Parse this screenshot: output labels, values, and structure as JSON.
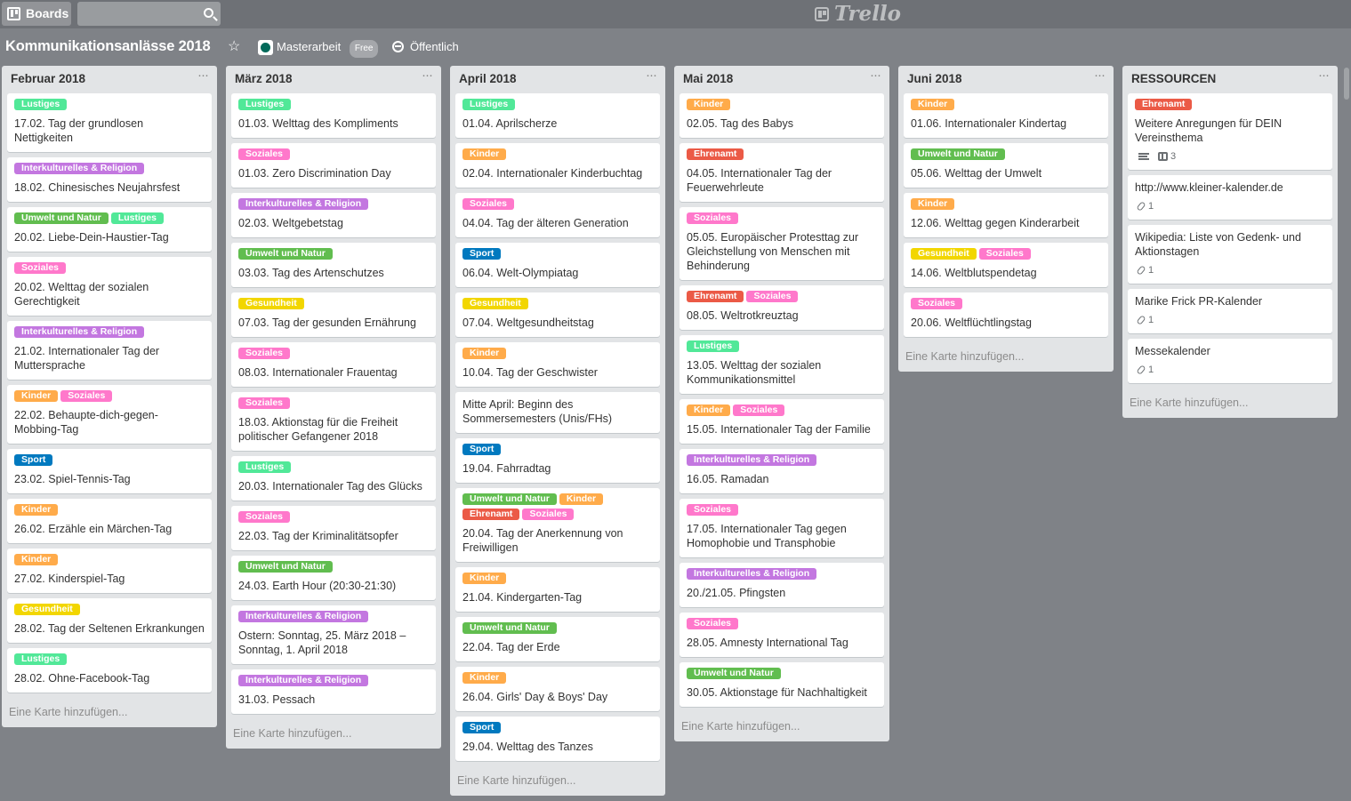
{
  "header": {
    "boards_label": "Boards",
    "search_placeholder": "",
    "logo_text": "Trello"
  },
  "board": {
    "title": "Kommunikationsanlässe 2018",
    "team": "Masterarbeit",
    "team_badge": "Free",
    "visibility": "Öffentlich"
  },
  "colors": {
    "Lustiges": "#51e898",
    "Interkulturelles & Religion": "#c377e0",
    "Umwelt und Natur": "#61bd4f",
    "Soziales": "#ff78cb",
    "Kinder": "#ffab4a",
    "Sport": "#0079bf",
    "Gesundheit": "#f2d600",
    "Ehrenamt": "#eb5a46"
  },
  "lists": [
    {
      "title": "Februar 2018",
      "add_label": "Eine Karte hinzufügen...",
      "cards": [
        {
          "labels": [
            "Lustiges"
          ],
          "title": "17.02. Tag der grundlosen Nettigkeiten"
        },
        {
          "labels": [
            "Interkulturelles & Religion"
          ],
          "title": "18.02. Chinesisches Neujahrsfest"
        },
        {
          "labels": [
            "Umwelt und Natur",
            "Lustiges"
          ],
          "title": "20.02. Liebe-Dein-Haustier-Tag"
        },
        {
          "labels": [
            "Soziales"
          ],
          "title": "20.02. Welttag der sozialen Gerechtigkeit"
        },
        {
          "labels": [
            "Interkulturelles & Religion"
          ],
          "title": "21.02. Internationaler Tag der Muttersprache"
        },
        {
          "labels": [
            "Kinder",
            "Soziales"
          ],
          "title": "22.02. Behaupte-dich-gegen-Mobbing-Tag"
        },
        {
          "labels": [
            "Sport"
          ],
          "title": "23.02. Spiel-Tennis-Tag"
        },
        {
          "labels": [
            "Kinder"
          ],
          "title": "26.02. Erzähle ein Märchen-Tag"
        },
        {
          "labels": [
            "Kinder"
          ],
          "title": "27.02. Kinderspiel-Tag"
        },
        {
          "labels": [
            "Gesundheit"
          ],
          "title": "28.02. Tag der Seltenen Erkrankungen"
        },
        {
          "labels": [
            "Lustiges"
          ],
          "title": "28.02. Ohne-Facebook-Tag"
        }
      ]
    },
    {
      "title": "März 2018",
      "add_label": "Eine Karte hinzufügen...",
      "cards": [
        {
          "labels": [
            "Lustiges"
          ],
          "title": "01.03. Welttag des Kompliments"
        },
        {
          "labels": [
            "Soziales"
          ],
          "title": "01.03. Zero Discrimination Day"
        },
        {
          "labels": [
            "Interkulturelles & Religion"
          ],
          "title": "02.03. Weltgebetstag"
        },
        {
          "labels": [
            "Umwelt und Natur"
          ],
          "title": "03.03. Tag des Artenschutzes"
        },
        {
          "labels": [
            "Gesundheit"
          ],
          "title": "07.03. Tag der gesunden Ernährung"
        },
        {
          "labels": [
            "Soziales"
          ],
          "title": "08.03. Internationaler Frauentag"
        },
        {
          "labels": [
            "Soziales"
          ],
          "title": "18.03. Aktionstag für die Freiheit politischer Gefangener 2018"
        },
        {
          "labels": [
            "Lustiges"
          ],
          "title": "20.03. Internationaler Tag des Glücks"
        },
        {
          "labels": [
            "Soziales"
          ],
          "title": "22.03. Tag der Kriminalitätsopfer"
        },
        {
          "labels": [
            "Umwelt und Natur"
          ],
          "title": "24.03. Earth Hour (20:30-21:30)"
        },
        {
          "labels": [
            "Interkulturelles & Religion"
          ],
          "title": "Ostern: Sonntag, 25. März 2018 – Sonntag, 1. April 2018"
        },
        {
          "labels": [
            "Interkulturelles & Religion"
          ],
          "title": "31.03. Pessach"
        }
      ]
    },
    {
      "title": "April 2018",
      "add_label": "Eine Karte hinzufügen...",
      "cards": [
        {
          "labels": [
            "Lustiges"
          ],
          "title": "01.04. Aprilscherze"
        },
        {
          "labels": [
            "Kinder"
          ],
          "title": "02.04. Internationaler Kinderbuchtag"
        },
        {
          "labels": [
            "Soziales"
          ],
          "title": "04.04. Tag der älteren Generation"
        },
        {
          "labels": [
            "Sport"
          ],
          "title": "06.04. Welt-Olympiatag"
        },
        {
          "labels": [
            "Gesundheit"
          ],
          "title": "07.04. Weltgesundheitstag"
        },
        {
          "labels": [
            "Kinder"
          ],
          "title": "10.04. Tag der Geschwister"
        },
        {
          "labels": [],
          "title": "Mitte April: Beginn des Sommersemesters (Unis/FHs)"
        },
        {
          "labels": [
            "Sport"
          ],
          "title": "19.04. Fahrradtag"
        },
        {
          "labels": [
            "Umwelt und Natur",
            "Kinder",
            "Ehrenamt",
            "Soziales"
          ],
          "title": "20.04. Tag der Anerkennung von Freiwilligen"
        },
        {
          "labels": [
            "Kinder"
          ],
          "title": "21.04. Kindergarten-Tag"
        },
        {
          "labels": [
            "Umwelt und Natur"
          ],
          "title": "22.04. Tag der Erde"
        },
        {
          "labels": [
            "Kinder"
          ],
          "title": "26.04. Girls' Day & Boys' Day"
        },
        {
          "labels": [
            "Sport"
          ],
          "title": "29.04. Welttag des Tanzes"
        }
      ]
    },
    {
      "title": "Mai 2018",
      "add_label": "Eine Karte hinzufügen...",
      "cards": [
        {
          "labels": [
            "Kinder"
          ],
          "title": "02.05. Tag des Babys"
        },
        {
          "labels": [
            "Ehrenamt"
          ],
          "title": "04.05. Internationaler Tag der Feuerwehrleute"
        },
        {
          "labels": [
            "Soziales"
          ],
          "title": "05.05. Europäischer Protesttag zur Gleichstellung von Menschen mit Behinderung"
        },
        {
          "labels": [
            "Ehrenamt",
            "Soziales"
          ],
          "title": "08.05. Weltrotkreuztag"
        },
        {
          "labels": [
            "Lustiges"
          ],
          "title": "13.05. Welttag der sozialen Kommunikationsmittel"
        },
        {
          "labels": [
            "Kinder",
            "Soziales"
          ],
          "title": "15.05. Internationaler Tag der Familie"
        },
        {
          "labels": [
            "Interkulturelles & Religion"
          ],
          "title": "16.05. Ramadan"
        },
        {
          "labels": [
            "Soziales"
          ],
          "title": "17.05. Internationaler Tag gegen Homophobie und Transphobie"
        },
        {
          "labels": [
            "Interkulturelles & Religion"
          ],
          "title": "20./21.05. Pfingsten"
        },
        {
          "labels": [
            "Soziales"
          ],
          "title": "28.05. Amnesty International Tag"
        },
        {
          "labels": [
            "Umwelt und Natur"
          ],
          "title": "30.05. Aktionstage für Nachhaltigkeit"
        }
      ]
    },
    {
      "title": "Juni 2018",
      "add_label": "Eine Karte hinzufügen...",
      "cards": [
        {
          "labels": [
            "Kinder"
          ],
          "title": "01.06. Internationaler Kindertag"
        },
        {
          "labels": [
            "Umwelt und Natur"
          ],
          "title": "05.06. Welttag der Umwelt"
        },
        {
          "labels": [
            "Kinder"
          ],
          "title": "12.06. Welttag gegen Kinderarbeit"
        },
        {
          "labels": [
            "Gesundheit",
            "Soziales"
          ],
          "title": "14.06. Weltblutspendetag"
        },
        {
          "labels": [
            "Soziales"
          ],
          "title": "20.06. Weltflüchtlingstag"
        }
      ]
    },
    {
      "title": "RESSOURCEN",
      "add_label": "Eine Karte hinzufügen...",
      "cards": [
        {
          "labels": [
            "Ehrenamt"
          ],
          "title": "Weitere Anregungen für DEIN Vereinsthema",
          "badges": {
            "description": true,
            "checklist": "3"
          }
        },
        {
          "labels": [],
          "title": "http://www.kleiner-kalender.de",
          "badges": {
            "attachments": "1"
          }
        },
        {
          "labels": [],
          "title": "Wikipedia: Liste von Gedenk- und Aktionstagen",
          "badges": {
            "attachments": "1"
          }
        },
        {
          "labels": [],
          "title": "Marike Frick PR-Kalender",
          "badges": {
            "attachments": "1"
          }
        },
        {
          "labels": [],
          "title": "Messekalender",
          "badges": {
            "attachments": "1"
          }
        }
      ]
    }
  ]
}
